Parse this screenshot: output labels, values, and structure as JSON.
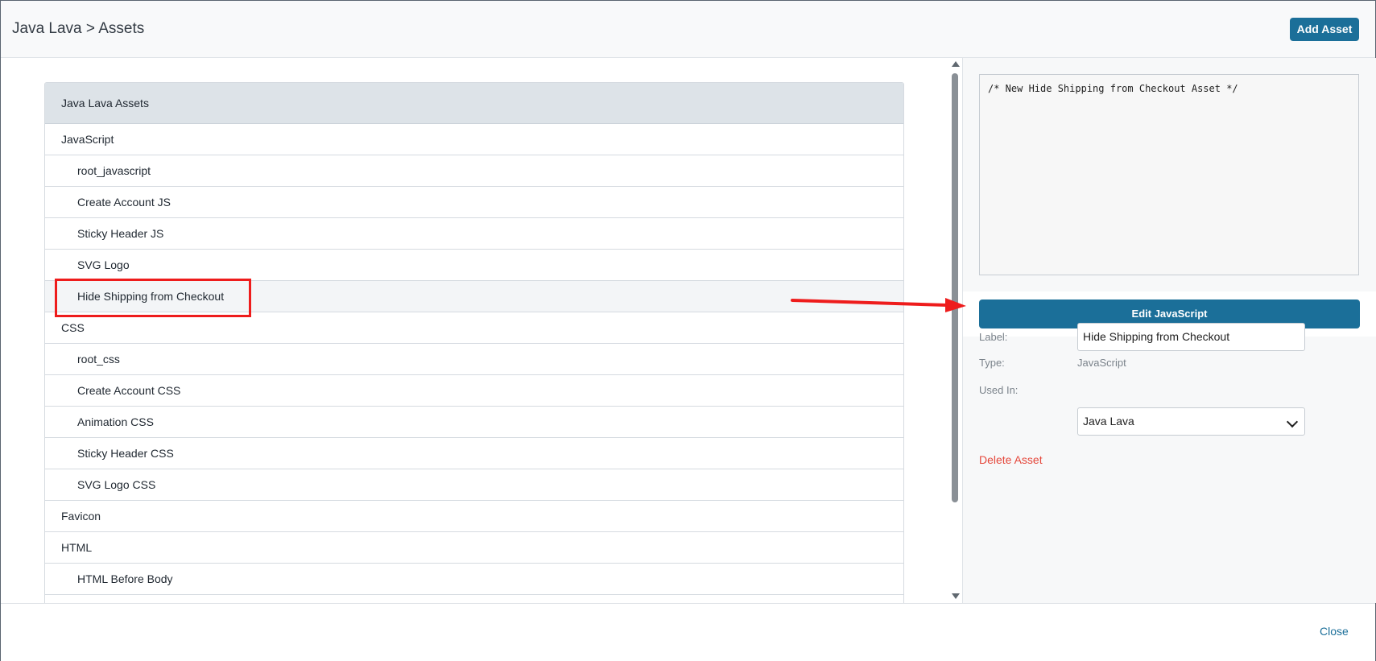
{
  "header": {
    "breadcrumb": "Java Lava > Assets",
    "add_button": "Add Asset"
  },
  "tree": {
    "title": "Java Lava Assets",
    "rows": [
      {
        "label": "JavaScript",
        "kind": "group"
      },
      {
        "label": "root_javascript",
        "kind": "child"
      },
      {
        "label": "Create Account JS",
        "kind": "child"
      },
      {
        "label": "Sticky Header JS",
        "kind": "child"
      },
      {
        "label": "SVG Logo",
        "kind": "child"
      },
      {
        "label": "Hide Shipping from Checkout",
        "kind": "child",
        "selected": true
      },
      {
        "label": "CSS",
        "kind": "group"
      },
      {
        "label": "root_css",
        "kind": "child"
      },
      {
        "label": "Create Account CSS",
        "kind": "child"
      },
      {
        "label": "Animation CSS",
        "kind": "child"
      },
      {
        "label": "Sticky Header CSS",
        "kind": "child"
      },
      {
        "label": "SVG Logo CSS",
        "kind": "child"
      },
      {
        "label": "Favicon",
        "kind": "group"
      },
      {
        "label": "HTML",
        "kind": "group"
      },
      {
        "label": "HTML Before Body",
        "kind": "child"
      },
      {
        "label": "",
        "kind": "child"
      }
    ]
  },
  "editor": {
    "code": "/* New Hide Shipping from Checkout Asset */",
    "edit_button": "Edit JavaScript"
  },
  "properties": {
    "label_caption": "Label:",
    "label_value": "Hide Shipping from Checkout",
    "type_caption": "Type:",
    "type_value": "JavaScript",
    "used_in_caption": "Used In:",
    "used_in_value": "Java Lava"
  },
  "delete_link": "Delete Asset",
  "footer": {
    "close": "Close"
  },
  "colors": {
    "primary": "#1b6f99",
    "danger": "#e5483c",
    "annotation": "#ee1c1c"
  }
}
